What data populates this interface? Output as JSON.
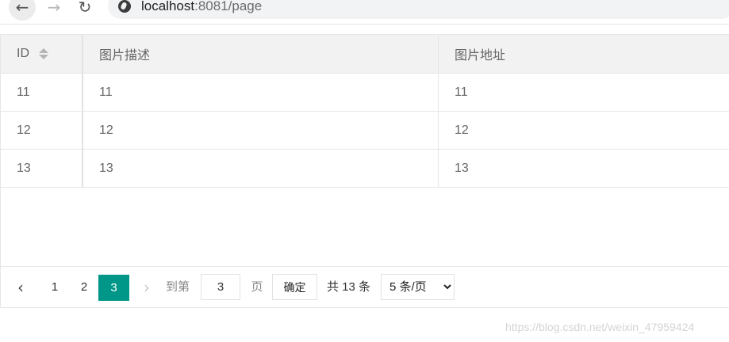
{
  "browser": {
    "url_host": "localhost",
    "url_path": ":8081/page"
  },
  "table": {
    "headers": [
      "ID",
      "图片描述",
      "图片地址"
    ],
    "rows": [
      [
        "11",
        "11",
        "11"
      ],
      [
        "12",
        "12",
        "12"
      ],
      [
        "13",
        "13",
        "13"
      ]
    ]
  },
  "pagination": {
    "prev": "‹",
    "pages": [
      "1",
      "2",
      "3"
    ],
    "current": "3",
    "next": "›",
    "goto_label": "到第",
    "goto_value": "3",
    "page_label": "页",
    "confirm_label": "确定",
    "total_label": "共 13 条",
    "page_size_options": [
      "5 条/页"
    ],
    "page_size_selected": "5 条/页"
  },
  "watermark": "https://blog.csdn.net/weixin_47959424",
  "colors": {
    "accent": "#009688",
    "header_bg": "#f2f2f2",
    "border": "#e6e6e6"
  },
  "icons": {
    "back": "arrow-left-icon",
    "forward": "arrow-right-icon",
    "reload": "reload-icon",
    "site": "globe-icon",
    "sort": "sort-icon"
  }
}
